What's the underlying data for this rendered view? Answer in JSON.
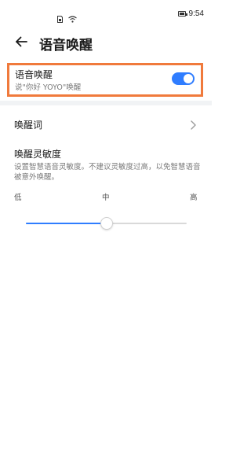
{
  "status_bar": {
    "time": "9:54",
    "icons": [
      "sim-card-icon",
      "wifi-icon",
      "battery-icon"
    ]
  },
  "header": {
    "title": "语音唤醒",
    "back_icon": "back-arrow-icon"
  },
  "voice_wake": {
    "label": "语音唤醒",
    "subtitle": "说\"你好 YOYO\"唤醒",
    "enabled": true,
    "toggle_color": "#2f7dff",
    "highlight_color": "#f07a3c"
  },
  "wake_word": {
    "label": "唤醒词",
    "icon": "chevron-right-icon"
  },
  "sensitivity": {
    "title": "唤醒灵敏度",
    "description": "设置智慧语音灵敏度。不建议灵敏度过高，以免智慧语音被意外唤醒。",
    "low_label": "低",
    "mid_label": "中",
    "high_label": "高",
    "value": 0.5,
    "accent_color": "#2f7dff"
  }
}
